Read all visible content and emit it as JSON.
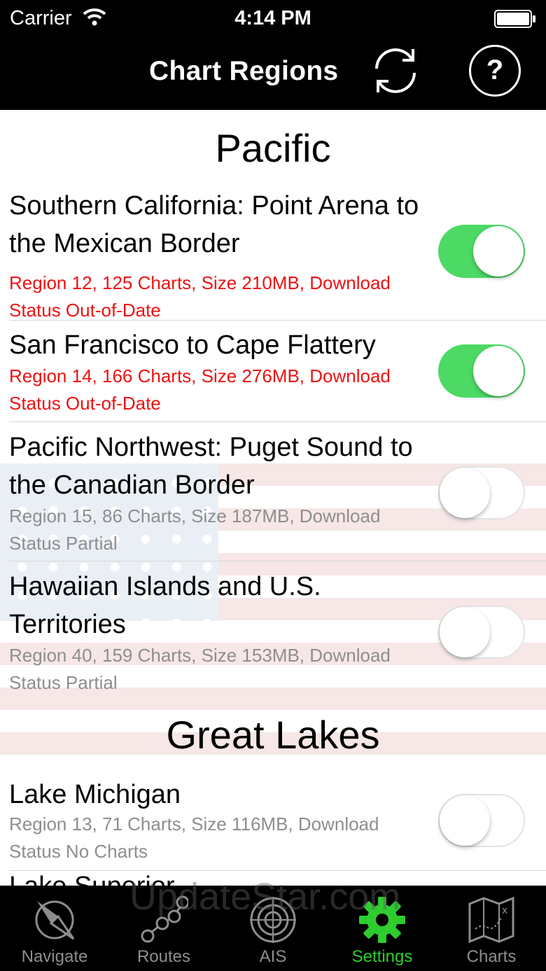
{
  "status_bar": {
    "carrier": "Carrier",
    "time": "4:14 PM"
  },
  "nav": {
    "title": "Chart Regions",
    "help_label": "?"
  },
  "sections": [
    {
      "header": "Pacific"
    },
    {
      "header": "Great Lakes"
    }
  ],
  "rows": [
    {
      "title": "Southern California: Point Arena to the Mexican Border",
      "detail": "Region 12, 125 Charts, Size 210MB, Download Status Out-of-Date",
      "enabled": true
    },
    {
      "title": "San Francisco to Cape Flattery",
      "detail": "Region 14, 166 Charts, Size 276MB, Download Status Out-of-Date",
      "enabled": true
    },
    {
      "title": "Pacific Northwest: Puget Sound to the Canadian Border",
      "detail": "Region 15, 86 Charts, Size 187MB, Download Status Partial",
      "enabled": false
    },
    {
      "title": "Hawaiian Islands and U.S. Territories",
      "detail": "Region 40, 159 Charts, Size 153MB, Download Status Partial",
      "enabled": false
    },
    {
      "title": "Lake Michigan",
      "detail": "Region 13, 71 Charts, Size 116MB, Download Status No Charts",
      "enabled": false
    }
  ],
  "partial_row_title": "Lake Superior ...",
  "tabs": [
    {
      "label": "Navigate",
      "icon": "compass-icon",
      "active": false
    },
    {
      "label": "Routes",
      "icon": "route-icon",
      "active": false
    },
    {
      "label": "AIS",
      "icon": "radar-icon",
      "active": false
    },
    {
      "label": "Settings",
      "icon": "gear-icon",
      "active": true
    },
    {
      "label": "Charts",
      "icon": "map-icon",
      "active": false
    }
  ],
  "watermark": "UpdateStar.com",
  "colors": {
    "toggle_on": "#4cd964",
    "warning_text": "#ee1111",
    "active_tab": "#2ecc2e"
  }
}
